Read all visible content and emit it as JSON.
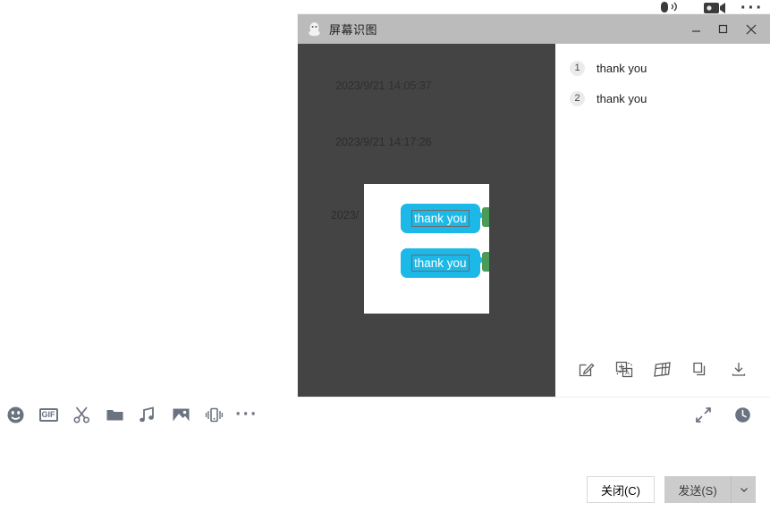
{
  "chat_window": {
    "top_icons": [
      {
        "name": "voice-call-icon",
        "label": "语音通话"
      },
      {
        "name": "video-call-icon",
        "label": "视频通话"
      },
      {
        "name": "more-options-icon",
        "label": "更多"
      }
    ],
    "toolbar_left": [
      {
        "name": "emoji-icon",
        "label": "表情"
      },
      {
        "name": "gif-icon",
        "label": "GIF"
      },
      {
        "name": "screenshot-scissors-icon",
        "label": "截图"
      },
      {
        "name": "folder-icon",
        "label": "文件"
      },
      {
        "name": "audio-message-icon",
        "label": "语音消息"
      },
      {
        "name": "image-icon",
        "label": "图片"
      },
      {
        "name": "shake-window-icon",
        "label": "窗口抖动"
      },
      {
        "name": "more-tools-icon",
        "label": "更多"
      }
    ],
    "toolbar_right": [
      {
        "name": "expand-icon",
        "label": "全屏"
      },
      {
        "name": "history-clock-icon",
        "label": "聊天记录"
      }
    ],
    "footer": {
      "close_label": "关闭(C)",
      "send_label": "发送(S)",
      "send_dropdown_icon": "chevron-down-icon"
    }
  },
  "dialog": {
    "title": "屏幕识图",
    "app_icon": "qq-penguin-icon",
    "window_controls": [
      {
        "name": "minimize-button",
        "glyph": "—"
      },
      {
        "name": "maximize-button",
        "glyph": "▢"
      },
      {
        "name": "close-button",
        "glyph": "✕"
      }
    ],
    "preview": {
      "timestamps": [
        "2023/9/21 14:05:37",
        "2023/9/21 14:17:26",
        "2023/"
      ],
      "selection": {
        "bubbles": [
          {
            "text": "thank you"
          },
          {
            "text": "thank you"
          }
        ]
      }
    },
    "results": {
      "items": [
        {
          "index": "1",
          "text": "thank you"
        },
        {
          "index": "2",
          "text": "thank you"
        }
      ],
      "toolbar": [
        {
          "name": "edit-pencil-icon",
          "label": "编辑"
        },
        {
          "name": "translate-icon",
          "label": "翻译"
        },
        {
          "name": "extract-table-icon",
          "label": "提取表格"
        },
        {
          "name": "copy-icon",
          "label": "复制"
        },
        {
          "name": "download-icon",
          "label": "下载"
        }
      ]
    }
  },
  "colors": {
    "bubble": "#1cb8e8",
    "dialog_titlebar": "#bbbbbb",
    "preview_bg": "#444444",
    "send_button": "#cccccc",
    "icon_gray": "#6b7280"
  }
}
